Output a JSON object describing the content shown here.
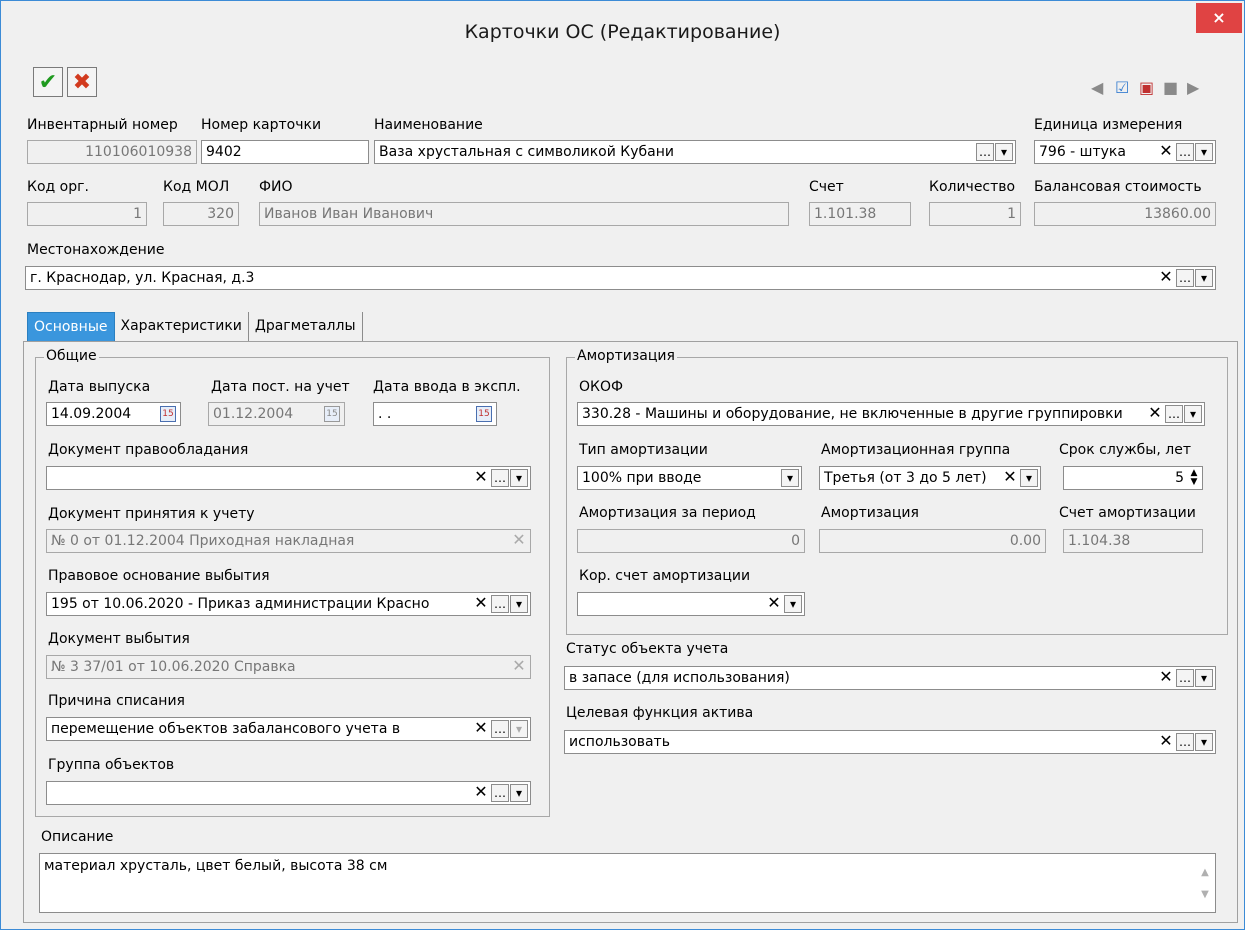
{
  "window": {
    "title": "Карточки ОС (Редактирование)",
    "close": "×"
  },
  "toolbar": {
    "ok": "✔",
    "cancel": "✖"
  },
  "header": {
    "inv_label": "Инвентарный номер",
    "inv_value": "110106010938",
    "card_label": "Номер карточки",
    "card_value": "9402",
    "name_label": "Наименование",
    "name_value": "Ваза хрустальная с символикой Кубани",
    "unit_label": "Единица измерения",
    "unit_value": "796 - штука",
    "org_label": "Код орг.",
    "org_value": "1",
    "mol_label": "Код МОЛ",
    "mol_value": "320",
    "fio_label": "ФИО",
    "fio_value": "Иванов Иван Иванович",
    "account_label": "Счет",
    "account_value": "1.101.38",
    "qty_label": "Количество",
    "qty_value": "1",
    "balance_label": "Балансовая стоимость",
    "balance_value": "13860.00",
    "location_label": "Местонахождение",
    "location_value": "г. Краснодар, ул. Красная, д.3"
  },
  "tabs": [
    "Основные",
    "Характеристики",
    "Драгметаллы"
  ],
  "general": {
    "title": "Общие",
    "release_label": "Дата выпуска",
    "release_value": "14.09.2004",
    "registered_label": "Дата пост. на учет",
    "registered_value": "01.12.2004",
    "commission_label": "Дата ввода в экспл.",
    "commission_value": " .  .",
    "ownership_doc_label": "Документ правообладания",
    "ownership_doc_value": "",
    "accept_doc_label": "Документ принятия к учету",
    "accept_doc_value": "№ 0 от 01.12.2004 Приходная накладная",
    "legal_basis_label": "Правовое основание выбытия",
    "legal_basis_value": "195 от 10.06.2020 - Приказ администрации Красно",
    "disposal_doc_label": "Документ выбытия",
    "disposal_doc_value": "№ 3 37/01 от 10.06.2020 Справка",
    "writeoff_label": "Причина списания",
    "writeoff_value": "перемещение объектов забалансового учета в",
    "group_label": "Группа объектов",
    "group_value": ""
  },
  "amort": {
    "title": "Амортизация",
    "okof_label": "ОКОФ",
    "okof_value": "330.28 - Машины и оборудование, не включенные в другие группировки",
    "type_label": "Тип амортизации",
    "type_value": "100% при вводе",
    "group_label": "Амортизационная группа",
    "group_value": "Третья (от 3 до 5 лет)",
    "life_label": "Срок службы, лет",
    "life_value": "5",
    "period_label": "Амортизация за период",
    "period_value": "0",
    "amort_label": "Амортизация",
    "amort_value": "0.00",
    "account_label": "Счет амортизации",
    "account_value": "1.104.38",
    "corr_label": "Кор. счет амортизации",
    "corr_value": ""
  },
  "status": {
    "status_label": "Статус объекта учета",
    "status_value": "в запасе (для использования)",
    "target_label": "Целевая функция актива",
    "target_value": "использовать"
  },
  "description": {
    "label": "Описание",
    "value": "материал хрусталь, цвет белый, высота 38 см"
  }
}
